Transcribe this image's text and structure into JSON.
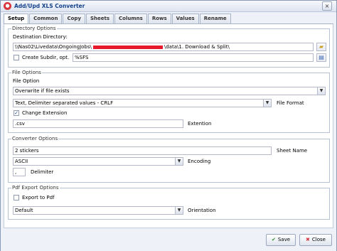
{
  "window": {
    "title": "Add/Upd XLS Converter"
  },
  "tabs": [
    "Setup",
    "Common",
    "Copy",
    "Sheets",
    "Columns",
    "Rows",
    "Values",
    "Rename"
  ],
  "directory_options": {
    "legend": "Directory Options",
    "destination_label": "Destination Directory:",
    "destination_prefix": "\\\\Nas02\\Livedata\\OngoingJobs\\",
    "destination_suffix": "\\data\\1. Download & Split\\",
    "create_subdir_label": "Create Subdir, opt.",
    "create_subdir_checked": false,
    "subdir_value": "%SFS"
  },
  "file_options": {
    "legend": "File Options",
    "file_option_label": "File Option",
    "file_option_value": "Overwrite if file exists",
    "file_format_value": "Text, Delimiter separated values - CRLF",
    "file_format_label": "File Format",
    "change_extension_label": "Change Extension",
    "change_extension_checked": true,
    "extension_value": ".csv",
    "extension_label": "Extention"
  },
  "converter_options": {
    "legend": "Converter Options",
    "sheet_name_value": "2 stickers",
    "sheet_name_label": "Sheet Name",
    "encoding_value": "ASCII",
    "encoding_label": "Encoding",
    "delimiter_value": ",",
    "delimiter_label": "Delimiter"
  },
  "pdf_export_options": {
    "legend": "Pdf Export Options",
    "export_to_pdf_label": "Export to Pdf",
    "export_to_pdf_checked": false,
    "orientation_value": "Default",
    "orientation_label": "Orientation"
  },
  "buttons": {
    "save": "Save",
    "close": "Close"
  },
  "colors": {
    "accent": "#15428b",
    "close_icon": "#d8343a",
    "save_icon": "#2e8b2e",
    "redaction": "#e8192a"
  }
}
